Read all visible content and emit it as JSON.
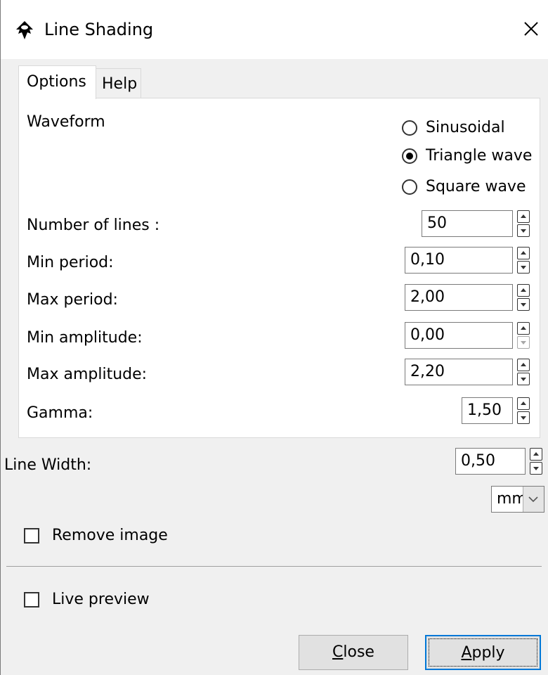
{
  "window": {
    "title": "Line Shading",
    "close_icon": "close-icon",
    "app_icon": "inkscape-icon"
  },
  "tabs": [
    {
      "label": "Options",
      "selected": true
    },
    {
      "label": "Help",
      "selected": false
    }
  ],
  "options": {
    "waveform": {
      "label": "Waveform",
      "choices": [
        {
          "label": "Sinusoidal",
          "checked": false
        },
        {
          "label": "Triangle wave",
          "checked": true
        },
        {
          "label": "Square wave",
          "checked": false
        }
      ]
    },
    "fields": [
      {
        "label": "Number of lines :",
        "value": "50"
      },
      {
        "label": "Min period:",
        "value": "0,10"
      },
      {
        "label": "Max period:",
        "value": "2,00"
      },
      {
        "label": "Min amplitude:",
        "value": "0,00"
      },
      {
        "label": "Max amplitude:",
        "value": "2,20"
      },
      {
        "label": "Gamma:",
        "value": "1,50"
      }
    ]
  },
  "line_width": {
    "label": "Line Width:",
    "value": "0,50",
    "unit": "mm"
  },
  "remove_image": {
    "label": "Remove image",
    "checked": false
  },
  "live_preview": {
    "label": "Live preview",
    "checked": false
  },
  "buttons": {
    "close_mnemonic": "C",
    "close_rest": "lose",
    "apply_mnemonic": "A",
    "apply_rest": "pply"
  },
  "colors": {
    "focus_border": "#0078d7",
    "window_bg": "#f0f0f0",
    "panel_bg": "#ffffff"
  }
}
